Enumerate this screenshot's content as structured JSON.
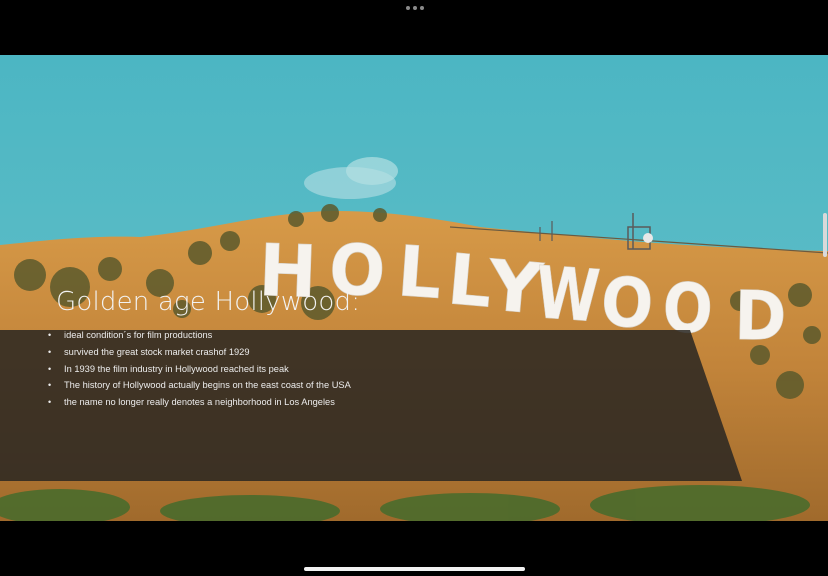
{
  "window": {
    "menu_icon": "three-dots-icon"
  },
  "slide": {
    "sign_text": "HOLLYWOOD",
    "title": "Golden age Hollywood:",
    "bullets": [
      "ideal condition´s for film productions",
      "survived the great stock market crashof 1929",
      "In 1939 the film industry in Hollywood reached its peak",
      "The history of Hollywood actually begins on the east coast of the USA",
      "the name no longer really denotes a neighborhood in Los Angeles"
    ],
    "colors": {
      "sky": "#55b8c4",
      "hill": "#c88a3e",
      "banner": "#2a2622",
      "text": "#f2f2f2"
    }
  }
}
